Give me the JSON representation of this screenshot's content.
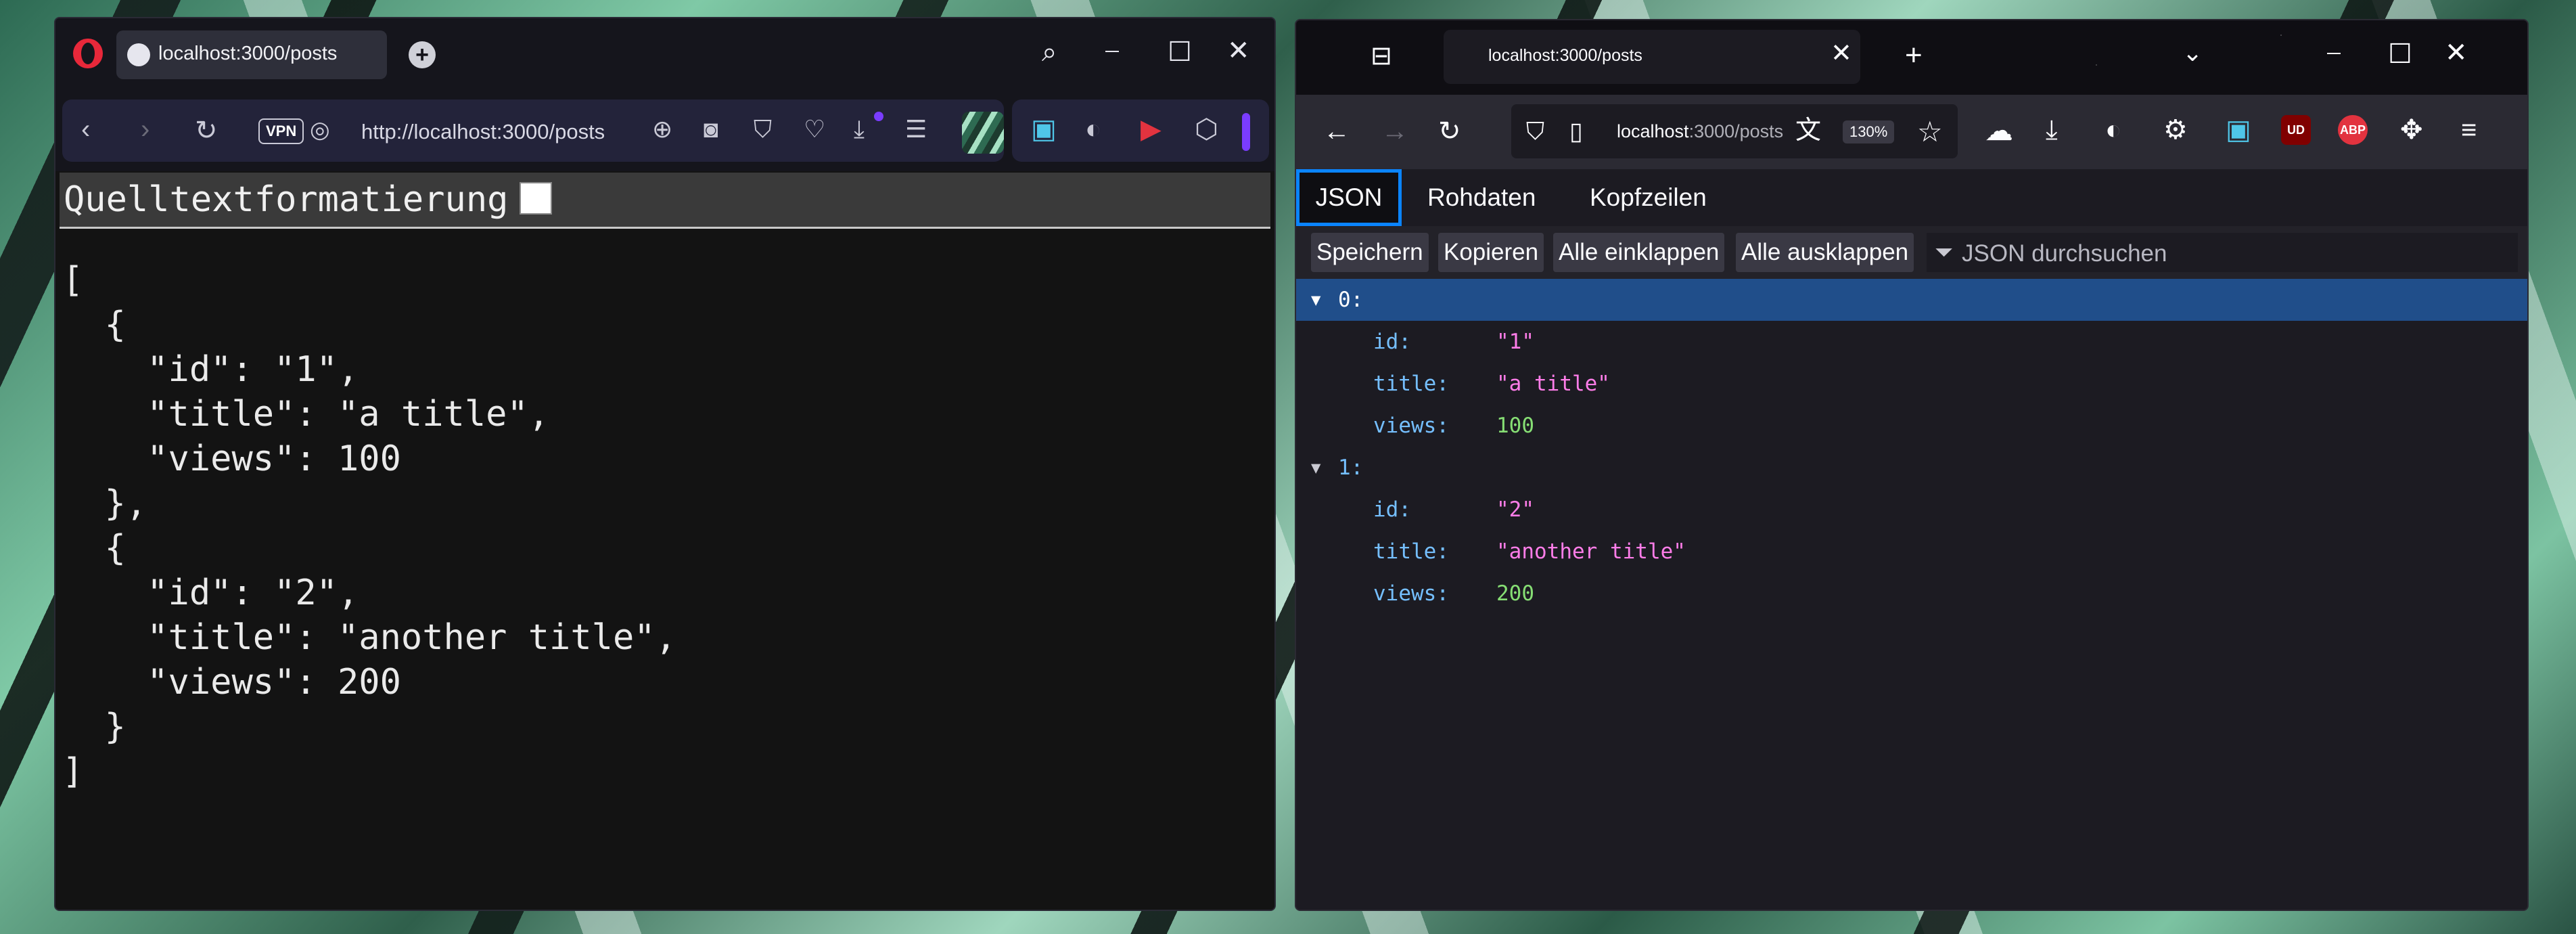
{
  "opera": {
    "tab": {
      "title": "localhost:3000/posts"
    },
    "address_bar": {
      "vpn_label": "VPN",
      "url": "http://localhost:3000/posts"
    },
    "content": {
      "pretty_print_label": "Quelltextformatierung",
      "raw_json": "[\n  {\n    \"id\": \"1\",\n    \"title\": \"a title\",\n    \"views\": 100\n  },\n  {\n    \"id\": \"2\",\n    \"title\": \"another title\",\n    \"views\": 200\n  }\n]"
    }
  },
  "firefox": {
    "tab": {
      "title": "localhost:3000/posts"
    },
    "address_bar": {
      "host": "localhost",
      "path": ":3000/posts",
      "zoom": "130%"
    },
    "viewer_tabs": [
      "JSON",
      "Rohdaten",
      "Kopfzeilen"
    ],
    "toolbar": {
      "save": "Speichern",
      "copy": "Kopieren",
      "collapse_all": "Alle einklappen",
      "expand_all": "Alle ausklappen",
      "filter_placeholder": "JSON durchsuchen"
    },
    "tree": [
      {
        "index": "0:",
        "fields": [
          {
            "key": "id:",
            "value": "\"1\""
          },
          {
            "key": "title:",
            "value": "\"a title\""
          },
          {
            "key": "views:",
            "value": "100"
          }
        ]
      },
      {
        "index": "1:",
        "fields": [
          {
            "key": "id:",
            "value": "\"2\""
          },
          {
            "key": "title:",
            "value": "\"another title\""
          },
          {
            "key": "views:",
            "value": "200"
          }
        ]
      }
    ],
    "extensions": {
      "ublock_badge": "UD",
      "adblock_badge": "ABP"
    }
  }
}
